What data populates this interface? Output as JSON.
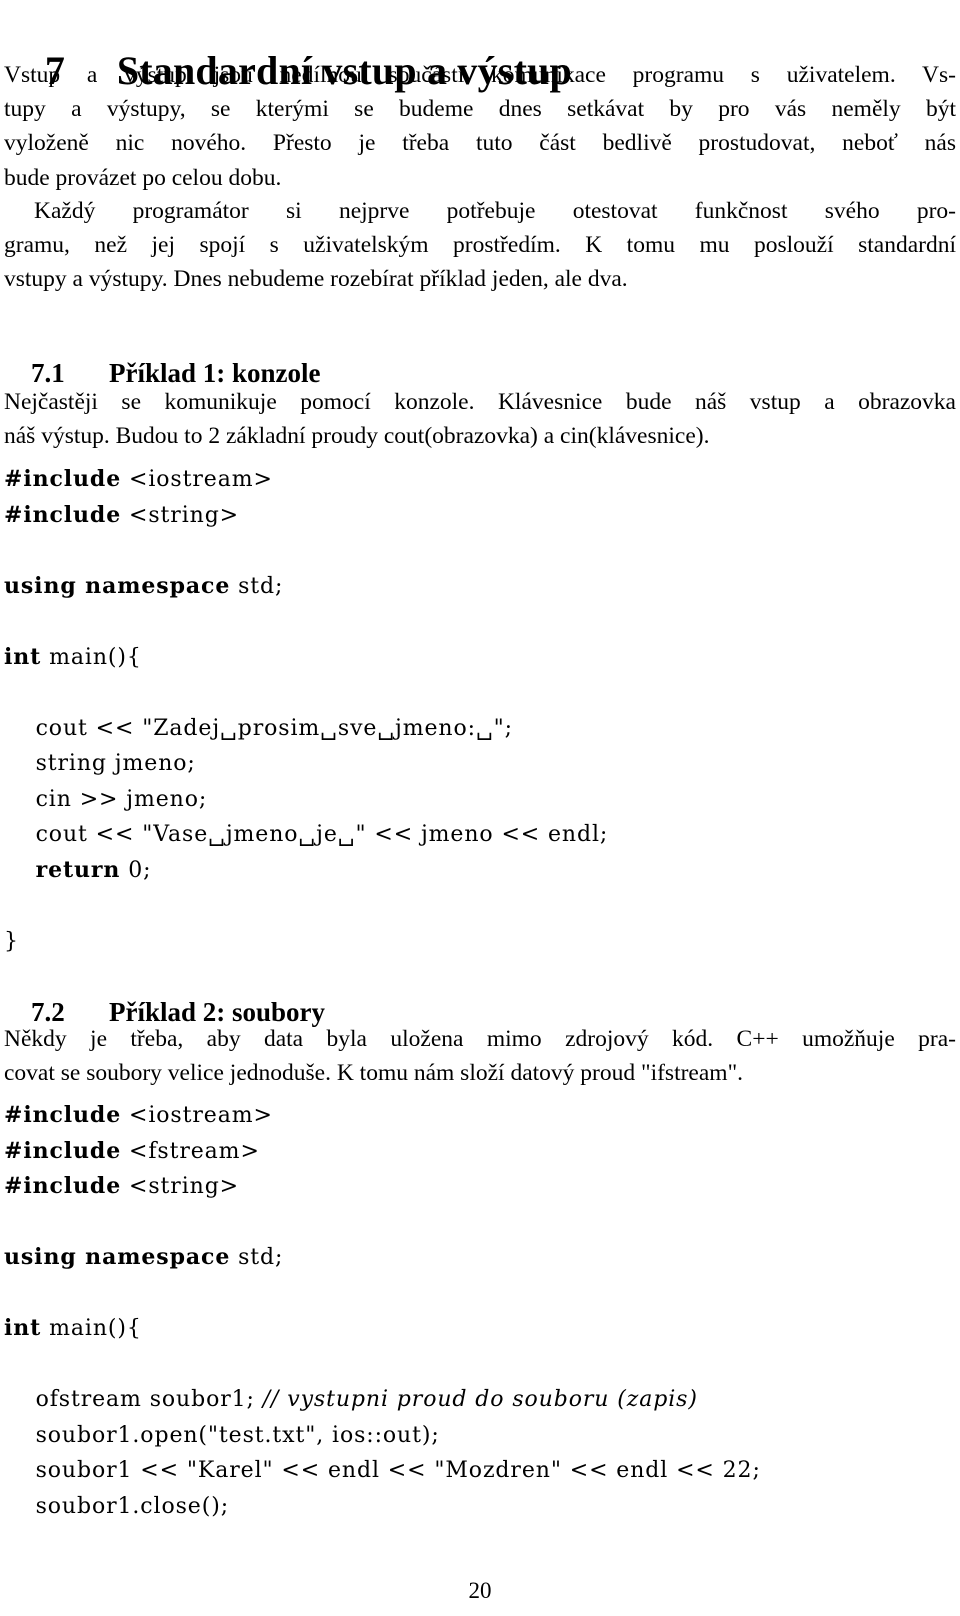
{
  "document": {
    "language": "cs",
    "page_number": "20"
  },
  "section": {
    "number": "7",
    "title": "Standardní vstup a výstup"
  },
  "intro": {
    "lines": [
      "Vstup a výstup jsou nedílnou součástí komunikace programu s uživatelem. Vs-",
      "tupy a výstupy, se kterými se budeme dnes setkávat by pro vás neměly být",
      "vyloženě nic nového. Přesto je třeba tuto část bedlivě prostudovat, neboť nás",
      "bude provázet po celou dobu."
    ]
  },
  "paragraph2": {
    "lines": [
      "Každý programátor si nejprve potřebuje otestovat funkčnost svého pro-",
      "gramu, než jej spojí s uživatelským prostředím. K tomu mu poslouží standardní",
      "vstupy a výstupy. Dnes nebudeme rozebírat příklad jeden, ale dva."
    ]
  },
  "subsection1": {
    "number": "7.1",
    "title": "Příklad 1: konzole",
    "paragraph_lines": [
      "Nejčastěji se komunikuje pomocí konzole. Klávesnice bude náš vstup a obrazovka",
      "náš výstup. Budou to 2 základní proudy cout(obrazovka) a cin(klávesnice)."
    ],
    "code": [
      {
        "parts": [
          {
            "t": "#include",
            "s": "kw"
          },
          {
            "t": " <iostream>",
            "s": ""
          }
        ]
      },
      {
        "parts": [
          {
            "t": "#include",
            "s": "kw"
          },
          {
            "t": " <string>",
            "s": ""
          }
        ]
      },
      {
        "parts": [
          {
            "t": "",
            "s": ""
          }
        ]
      },
      {
        "parts": [
          {
            "t": "using namespace",
            "s": "kw"
          },
          {
            "t": " std;",
            "s": ""
          }
        ]
      },
      {
        "parts": [
          {
            "t": "",
            "s": ""
          }
        ]
      },
      {
        "parts": [
          {
            "t": "int",
            "s": "kw"
          },
          {
            "t": " main(){",
            "s": ""
          }
        ]
      },
      {
        "parts": [
          {
            "t": "",
            "s": ""
          }
        ]
      },
      {
        "parts": [
          {
            "t": "    cout << \"Zadej␣prosim␣sve␣jmeno:␣\";",
            "s": ""
          }
        ]
      },
      {
        "parts": [
          {
            "t": "    string jmeno;",
            "s": ""
          }
        ]
      },
      {
        "parts": [
          {
            "t": "    cin >> jmeno;",
            "s": ""
          }
        ]
      },
      {
        "parts": [
          {
            "t": "    cout << \"Vase␣jmeno␣je␣\" << jmeno << endl;",
            "s": ""
          }
        ]
      },
      {
        "parts": [
          {
            "t": "    ",
            "s": ""
          },
          {
            "t": "return",
            "s": "kw"
          },
          {
            "t": " 0;",
            "s": ""
          }
        ]
      },
      {
        "parts": [
          {
            "t": "",
            "s": ""
          }
        ]
      },
      {
        "parts": [
          {
            "t": "}",
            "s": ""
          }
        ]
      }
    ]
  },
  "subsection2": {
    "number": "7.2",
    "title": "Příklad 2: soubory",
    "paragraph_lines": [
      "Někdy je třeba, aby data byla uložena mimo zdrojový kód. C++ umožňuje pra-",
      "covat se soubory velice jednoduše. K tomu nám složí datový proud \"ifstream\"."
    ],
    "code": [
      {
        "parts": [
          {
            "t": "#include",
            "s": "kw"
          },
          {
            "t": " <iostream>",
            "s": ""
          }
        ]
      },
      {
        "parts": [
          {
            "t": "#include",
            "s": "kw"
          },
          {
            "t": " <fstream>",
            "s": ""
          }
        ]
      },
      {
        "parts": [
          {
            "t": "#include",
            "s": "kw"
          },
          {
            "t": " <string>",
            "s": ""
          }
        ]
      },
      {
        "parts": [
          {
            "t": "",
            "s": ""
          }
        ]
      },
      {
        "parts": [
          {
            "t": "using namespace",
            "s": "kw"
          },
          {
            "t": " std;",
            "s": ""
          }
        ]
      },
      {
        "parts": [
          {
            "t": "",
            "s": ""
          }
        ]
      },
      {
        "parts": [
          {
            "t": "int",
            "s": "kw"
          },
          {
            "t": " main(){",
            "s": ""
          }
        ]
      },
      {
        "parts": [
          {
            "t": "",
            "s": ""
          }
        ]
      },
      {
        "parts": [
          {
            "t": "    ofstream soubor1; ",
            "s": ""
          },
          {
            "t": "// vystupni proud do souboru (zapis)",
            "s": "cm"
          }
        ]
      },
      {
        "parts": [
          {
            "t": "    soubor1.open(\"test.txt\", ios::out);",
            "s": ""
          }
        ]
      },
      {
        "parts": [
          {
            "t": "    soubor1 << \"Karel\" << endl << \"Mozdren\" << endl << 22;",
            "s": ""
          }
        ]
      },
      {
        "parts": [
          {
            "t": "    soubor1.close();",
            "s": ""
          }
        ]
      }
    ]
  }
}
